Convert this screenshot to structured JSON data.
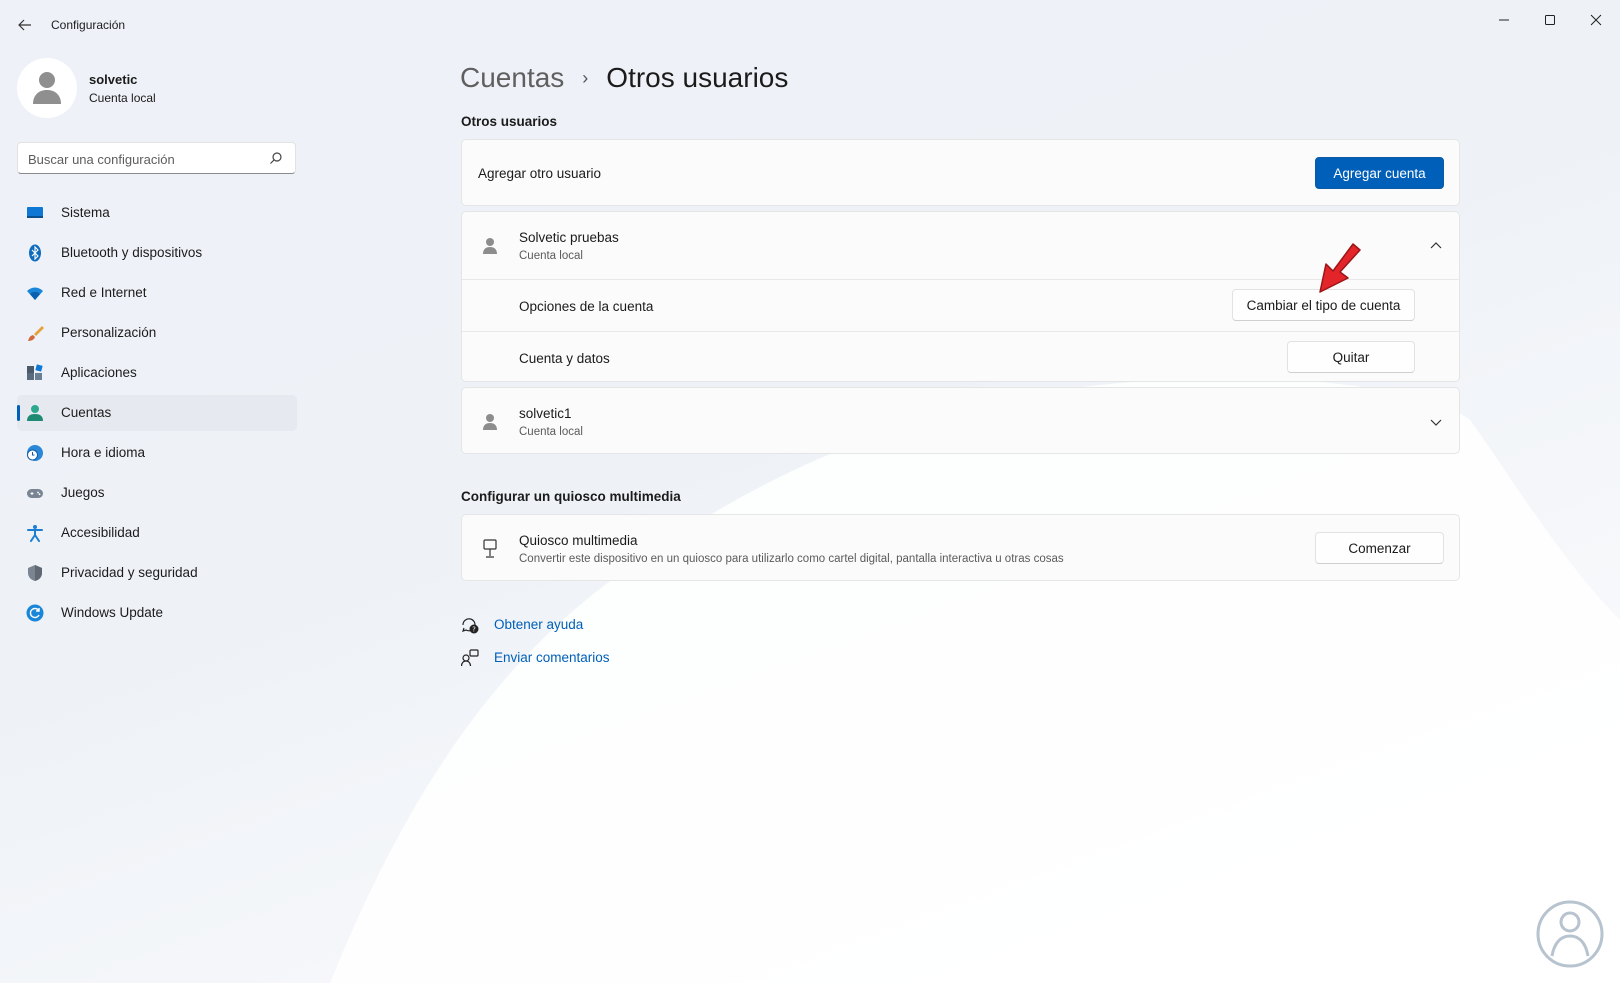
{
  "window": {
    "title": "Configuración",
    "back_icon": "arrow-left-icon",
    "controls": [
      "minimize-icon",
      "maximize-icon",
      "close-icon"
    ]
  },
  "profile": {
    "name": "solvetic",
    "account_type": "Cuenta local"
  },
  "search": {
    "placeholder": "Buscar una configuración",
    "value": ""
  },
  "sidebar": {
    "items": [
      {
        "label": "Sistema",
        "icon": "system-monitor-icon",
        "active": false
      },
      {
        "label": "Bluetooth y dispositivos",
        "icon": "bluetooth-icon",
        "active": false
      },
      {
        "label": "Red e Internet",
        "icon": "wifi-icon",
        "active": false
      },
      {
        "label": "Personalización",
        "icon": "paintbrush-icon",
        "active": false
      },
      {
        "label": "Aplicaciones",
        "icon": "apps-icon",
        "active": false
      },
      {
        "label": "Cuentas",
        "icon": "accounts-icon",
        "active": true
      },
      {
        "label": "Hora e idioma",
        "icon": "clock-globe-icon",
        "active": false
      },
      {
        "label": "Juegos",
        "icon": "gamepad-icon",
        "active": false
      },
      {
        "label": "Accesibilidad",
        "icon": "accessibility-icon",
        "active": false
      },
      {
        "label": "Privacidad y seguridad",
        "icon": "shield-icon",
        "active": false
      },
      {
        "label": "Windows Update",
        "icon": "windows-update-icon",
        "active": false
      }
    ]
  },
  "breadcrumb": {
    "parent": "Cuentas",
    "separator": "›",
    "current": "Otros usuarios"
  },
  "other_users": {
    "section_title": "Otros usuarios",
    "add_user_label": "Agregar otro usuario",
    "add_account_button": "Agregar cuenta",
    "users": [
      {
        "name": "Solvetic pruebas",
        "type": "Cuenta local",
        "expanded": true,
        "options_label": "Opciones de la cuenta",
        "change_type_button": "Cambiar el tipo de cuenta",
        "data_label": "Cuenta y datos",
        "remove_button": "Quitar"
      },
      {
        "name": "solvetic1",
        "type": "Cuenta local",
        "expanded": false
      }
    ]
  },
  "kiosk": {
    "section_title": "Configurar un quiosco multimedia",
    "title": "Quiosco multimedia",
    "description": "Convertir este dispositivo en un quiosco para utilizarlo como cartel digital, pantalla interactiva u otras cosas",
    "button": "Comenzar"
  },
  "links": {
    "help": "Obtener ayuda",
    "feedback": "Enviar comentarios"
  },
  "colors": {
    "accent": "#005fb8",
    "annotation_arrow": "#e3252a"
  }
}
